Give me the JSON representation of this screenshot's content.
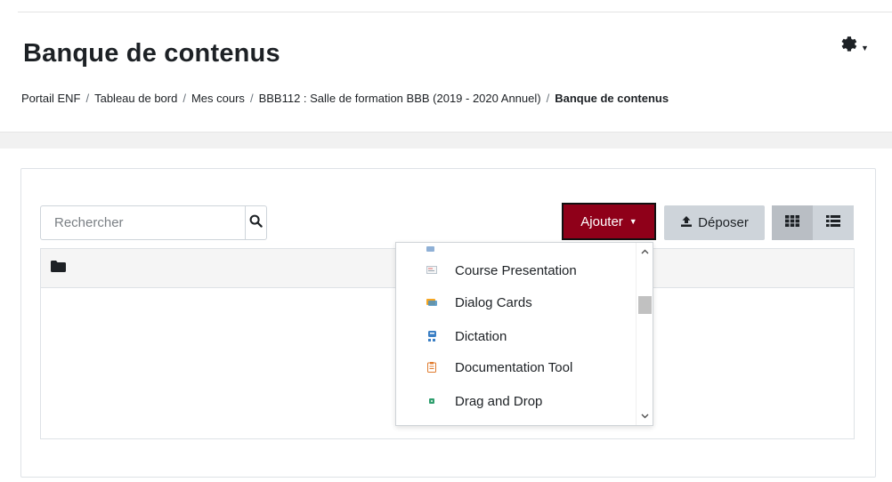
{
  "page_title": "Banque de contenus",
  "breadcrumb": [
    {
      "label": "Portail ENF"
    },
    {
      "label": "Tableau de bord"
    },
    {
      "label": "Mes cours"
    },
    {
      "label": "BBB112 : Salle de formation BBB (2019 - 2020 Annuel)"
    },
    {
      "label": "Banque de contenus",
      "current": true
    }
  ],
  "search": {
    "placeholder": "Rechercher",
    "value": ""
  },
  "toolbar": {
    "add_label": "Ajouter",
    "upload_label": "Déposer"
  },
  "add_menu": {
    "items": [
      {
        "label": "Course Presentation",
        "icon": "course-presentation-icon"
      },
      {
        "label": "Dialog Cards",
        "icon": "dialog-cards-icon"
      },
      {
        "label": "Dictation",
        "icon": "dictation-icon"
      },
      {
        "label": "Documentation Tool",
        "icon": "documentation-tool-icon"
      },
      {
        "label": "Drag and Drop",
        "icon": "drag-and-drop-icon"
      }
    ]
  },
  "colors": {
    "add_button_bg": "#8f0019",
    "secondary_button_bg": "#ced4da",
    "text": "#1d2125"
  }
}
